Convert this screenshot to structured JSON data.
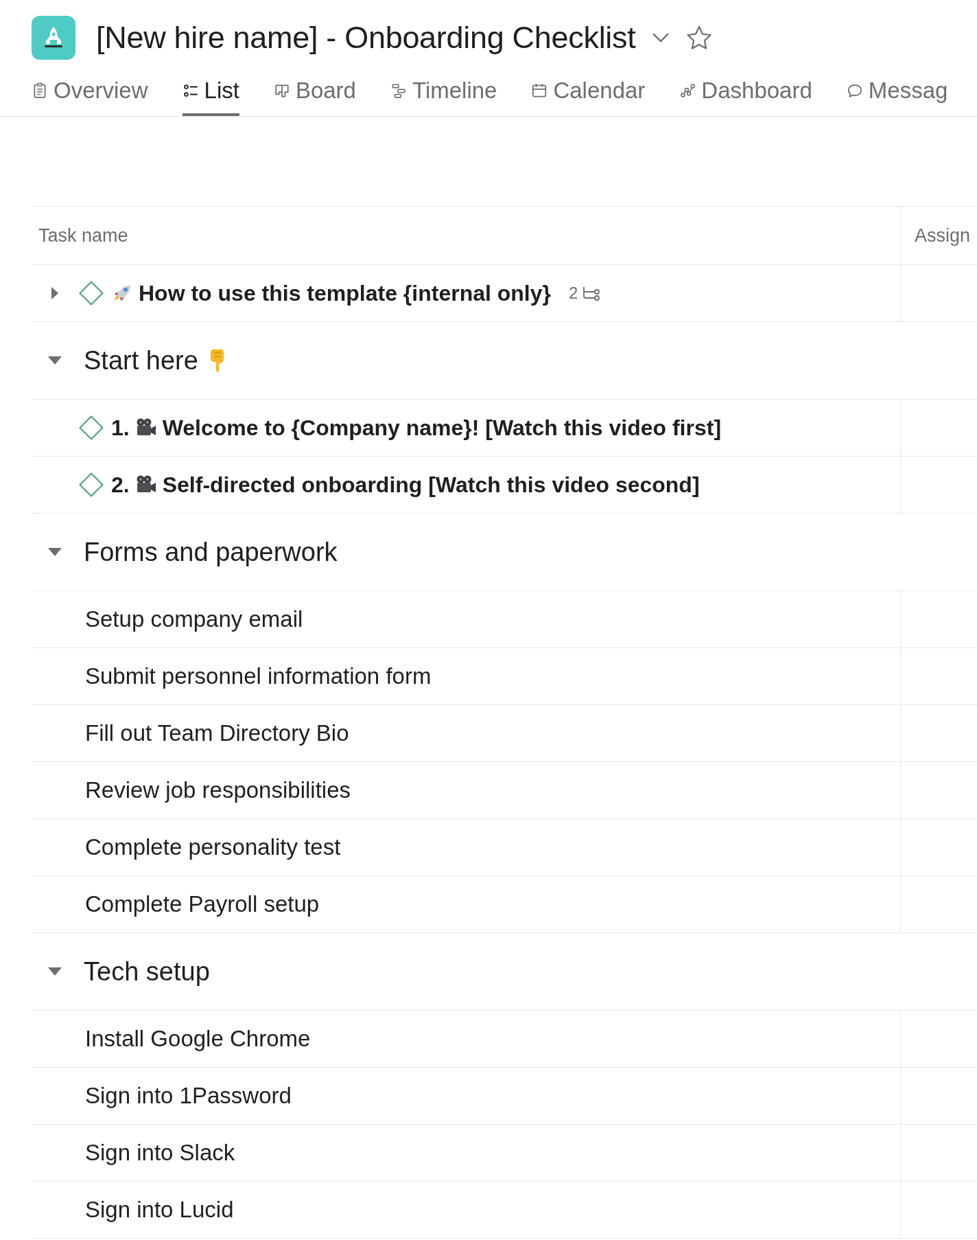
{
  "project": {
    "title": "[New hire name] - Onboarding Checklist"
  },
  "tabs": [
    {
      "label": "Overview",
      "selected": false
    },
    {
      "label": "List",
      "selected": true
    },
    {
      "label": "Board",
      "selected": false
    },
    {
      "label": "Timeline",
      "selected": false
    },
    {
      "label": "Calendar",
      "selected": false
    },
    {
      "label": "Dashboard",
      "selected": false
    },
    {
      "label": "Messag",
      "selected": false
    }
  ],
  "table": {
    "columns": [
      "Task name",
      "Assign"
    ],
    "rows": [
      {
        "kind": "template",
        "title": "How to use this template {internal only}",
        "expanded": false,
        "subtask_count": "2"
      },
      {
        "kind": "pointer_section",
        "title": "Start here",
        "expanded": true
      },
      {
        "kind": "video",
        "number": "1.",
        "title": "Welcome to {Company name}! [Watch this video first]"
      },
      {
        "kind": "video",
        "number": "2.",
        "title": "Self-directed onboarding [Watch this video second]"
      },
      {
        "kind": "section",
        "title": "Forms and paperwork",
        "expanded": true
      },
      {
        "kind": "plain",
        "title": "Setup company email"
      },
      {
        "kind": "plain",
        "title": "Submit personnel information form"
      },
      {
        "kind": "plain",
        "title": "Fill out Team Directory Bio"
      },
      {
        "kind": "plain",
        "title": "Review job responsibilities"
      },
      {
        "kind": "plain",
        "title": "Complete personality test"
      },
      {
        "kind": "plain",
        "title": "Complete Payroll setup"
      },
      {
        "kind": "section",
        "title": "Tech setup",
        "expanded": true
      },
      {
        "kind": "plain",
        "title": "Install Google Chrome"
      },
      {
        "kind": "plain",
        "title": "Sign into 1Password"
      },
      {
        "kind": "plain",
        "title": "Sign into Slack"
      },
      {
        "kind": "plain",
        "title": "Sign into Lucid"
      }
    ]
  }
}
